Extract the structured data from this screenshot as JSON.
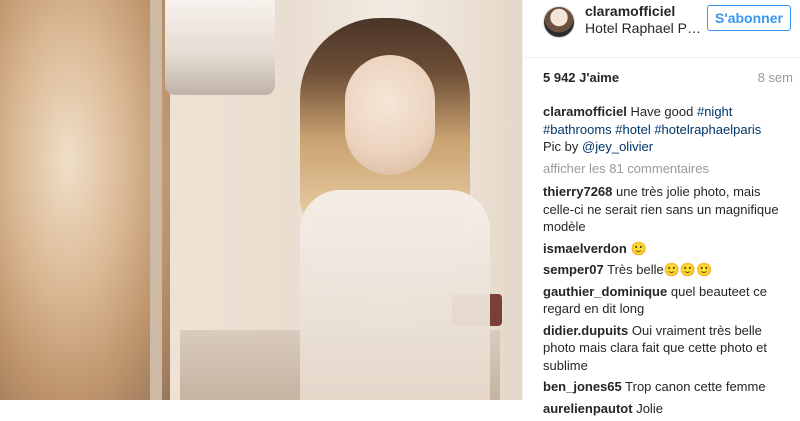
{
  "post": {
    "username": "claramofficiel",
    "location": "Hotel Raphael Paris",
    "follow_label": "S'abonner",
    "likes": "5 942 J'aime",
    "time": "8 sem",
    "caption": {
      "user": "claramofficiel",
      "text": "Have good",
      "tags": [
        "#night",
        "#bathrooms",
        "#hotel",
        "#hotelraphaelparis"
      ],
      "credit": "Pic by",
      "credit_handle": "@jey_olivier"
    },
    "view_more": "afficher les 81 commentaires"
  },
  "comments": [
    {
      "user": "thierry7268",
      "text": "une très jolie photo, mais celle-ci ne serait rien sans un magnifique modèle"
    },
    {
      "user": "ismaelverdon",
      "text": "🙂"
    },
    {
      "user": "semper07",
      "text": "Très belle🙂🙂🙂"
    },
    {
      "user": "gauthier_dominique",
      "text": "quel beauteet ce regard en dit long"
    },
    {
      "user": "didier.dupuits",
      "text": "Oui vraiment très belle photo mais clara fait que cette photo et sublime"
    },
    {
      "user": "ben_jones65",
      "text": "Trop canon cette femme"
    },
    {
      "user": "aurelienpautot",
      "text": "Jolie"
    }
  ]
}
